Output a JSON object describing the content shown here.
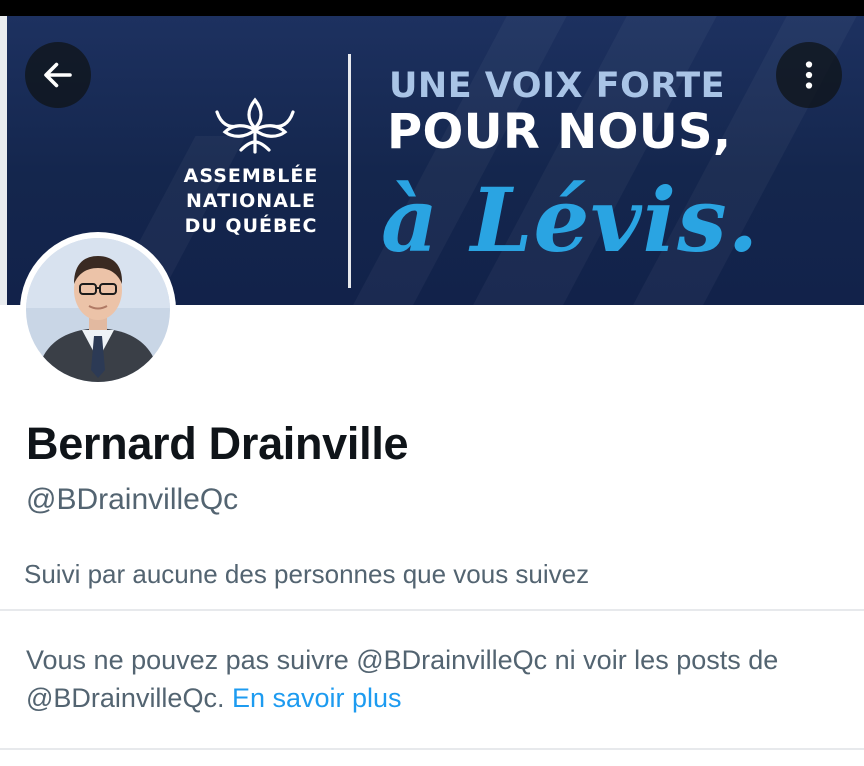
{
  "banner": {
    "institution": "ASSEMBLÉE NATIONALE DU QUÉBEC",
    "institution_lines": [
      "ASSEMBLÉE",
      "NATIONALE",
      "DU QUÉBEC"
    ],
    "slogan_line1": "UNE VOIX FORTE",
    "slogan_line2": "POUR NOUS,",
    "slogan_line3": "à Lévis.",
    "colors": {
      "background": "#14264d",
      "slogan_accent": "#2aa4e2",
      "slogan_muted": "#a9c4e6"
    }
  },
  "toolbar": {
    "back_icon": "arrow-left-icon",
    "more_icon": "more-vertical-icon"
  },
  "profile": {
    "name": "Bernard Drainville",
    "handle": "@BDrainvilleQc",
    "followed_by": "Suivi par aucune des personnes que vous suivez"
  },
  "notice": {
    "text": "Vous ne pouvez pas suivre @BDrainvilleQc ni voir les posts de @BDrainvilleQc.",
    "link_label": "En savoir plus"
  },
  "colors": {
    "link": "#1d9bf0",
    "secondary_text": "#536471",
    "primary_text": "#0f1419"
  }
}
